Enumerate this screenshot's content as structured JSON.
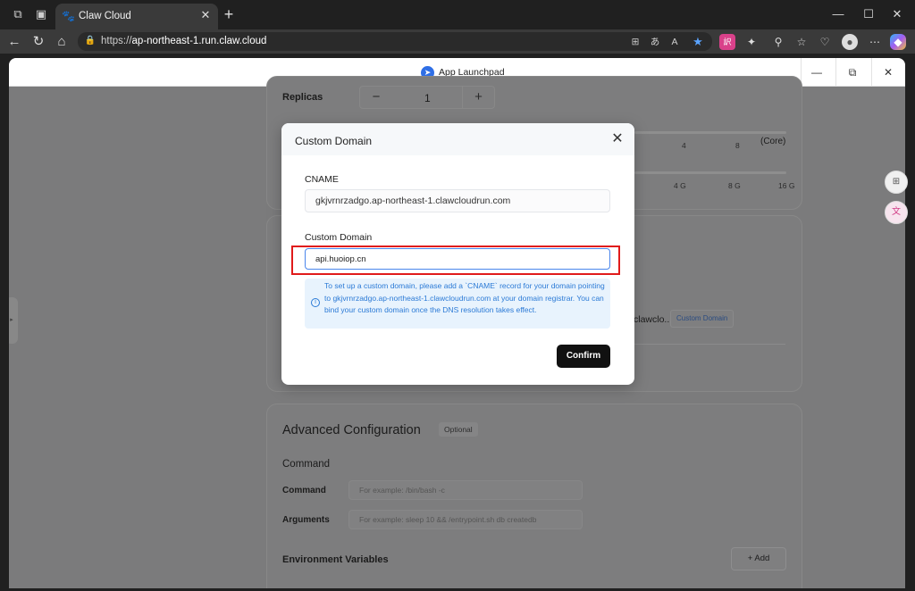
{
  "browser": {
    "tab_title": "Claw Cloud",
    "url_scheme": "https://",
    "url_host": "ap-northeast-1.run.claw.cloud",
    "window_controls": {
      "minimize": "—",
      "maximize": "☐",
      "close": "✕"
    }
  },
  "app": {
    "title": "App Launchpad"
  },
  "background": {
    "replicas_label": "Replicas",
    "replicas_value": "1",
    "cpu_ticks": [
      "4",
      "8"
    ],
    "cpu_unit": "(Core)",
    "memory_ticks": [
      "4 G",
      "8 G",
      "16 G"
    ],
    "domain_truncated": "clawclo...",
    "custom_domain_link": "Custom Domain",
    "advanced_title": "Advanced Configuration",
    "optional_badge": "Optional",
    "command_section": "Command",
    "command_label": "Command",
    "command_placeholder": "For example: /bin/bash -c",
    "arguments_label": "Arguments",
    "arguments_placeholder": "For example: sleep 10 && /entrypoint.sh db createdb",
    "env_title": "Environment Variables",
    "add_button": "+ Add"
  },
  "modal": {
    "title": "Custom Domain",
    "cname_label": "CNAME",
    "cname_value": "gkjvrnrzadgo.ap-northeast-1.clawcloudrun.com",
    "domain_label": "Custom Domain",
    "domain_value": "api.huoiop.cn",
    "info": "To set up a custom domain, please add a `CNAME` record for your domain pointing to gkjvrnrzadgo.ap-northeast-1.clawcloudrun.com at your domain registrar. You can bind your custom domain once the DNS resolution takes effect.",
    "confirm": "Confirm"
  },
  "colors": {
    "accent": "#4a86ec",
    "highlight": "#e01b1b",
    "info_text": "#2b7ad6",
    "info_bg": "#e8f3fd",
    "confirm_bg": "#111111"
  }
}
